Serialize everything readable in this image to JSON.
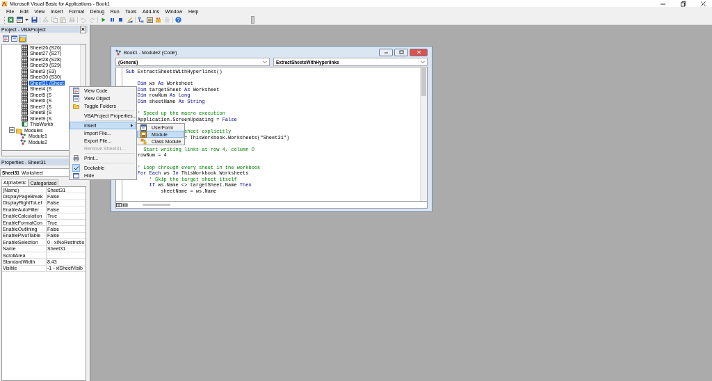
{
  "window": {
    "title": "Microsoft Visual Basic for Applications - Book1"
  },
  "menu_bar": [
    "File",
    "Edit",
    "View",
    "Insert",
    "Format",
    "Debug",
    "Run",
    "Tools",
    "Add-Ins",
    "Window",
    "Help"
  ],
  "toolbar": [
    {
      "kind": "excel",
      "disabled": false
    },
    {
      "kind": "userform",
      "disabled": false
    },
    {
      "kind": "save",
      "disabled": false
    },
    {
      "kind": "cut",
      "disabled": true
    },
    {
      "kind": "copy",
      "disabled": true
    },
    {
      "kind": "paste",
      "disabled": true
    },
    {
      "kind": "find",
      "disabled": true
    },
    {
      "kind": "undo",
      "disabled": true
    },
    {
      "kind": "redo",
      "disabled": true
    },
    {
      "kind": "run",
      "disabled": false
    },
    {
      "kind": "break",
      "disabled": false
    },
    {
      "kind": "reset",
      "disabled": false
    },
    {
      "kind": "design",
      "disabled": false
    },
    {
      "kind": "explorer",
      "disabled": false
    },
    {
      "kind": "properties",
      "disabled": false
    },
    {
      "kind": "browser",
      "disabled": false
    },
    {
      "kind": "toolbox",
      "disabled": true
    },
    {
      "kind": "help",
      "disabled": false
    }
  ],
  "project": {
    "title": "Project - VBAProject",
    "close": "×",
    "toolbar": [
      {
        "kind": "code",
        "pressed": false
      },
      {
        "kind": "object",
        "pressed": false
      },
      {
        "kind": "folders",
        "pressed": true
      }
    ],
    "tree": [
      {
        "label": "Sheet26 (S26)",
        "kind": "sheet",
        "selected": false
      },
      {
        "label": "Sheet27 (S27)",
        "kind": "sheet",
        "selected": false
      },
      {
        "label": "Sheet28 (S28)",
        "kind": "sheet",
        "selected": false
      },
      {
        "label": "Sheet29 (S29)",
        "kind": "sheet",
        "selected": false
      },
      {
        "label": "Sheet3 (S3)",
        "kind": "sheet",
        "selected": false
      },
      {
        "label": "Sheet30 (S30)",
        "kind": "sheet",
        "selected": false
      },
      {
        "label": "Sheet31 (Sheet",
        "kind": "sheet",
        "selected": true
      },
      {
        "label": "Sheet4 (S",
        "kind": "sheet",
        "selected": false
      },
      {
        "label": "Sheet5 (S",
        "kind": "sheet",
        "selected": false
      },
      {
        "label": "Sheet6 (S",
        "kind": "sheet",
        "selected": false
      },
      {
        "label": "Sheet7 (S",
        "kind": "sheet",
        "selected": false
      },
      {
        "label": "Sheet8 (S",
        "kind": "sheet",
        "selected": false
      },
      {
        "label": "Sheet9 (S",
        "kind": "sheet",
        "selected": false
      },
      {
        "label": "ThisWorkb",
        "kind": "workbook",
        "selected": false
      },
      {
        "label": "Modules",
        "kind": "folder",
        "selected": false,
        "expanded": true,
        "children": [
          {
            "label": "Module1",
            "kind": "module",
            "selected": false
          },
          {
            "label": "Module2",
            "kind": "module",
            "selected": false
          }
        ]
      }
    ]
  },
  "properties": {
    "title": "Properties - Sheet31",
    "object_name": "Sheet31",
    "object_type": "Worksheet",
    "tabs": [
      {
        "label": "Alphabetic",
        "selected": true
      },
      {
        "label": "Categorized",
        "selected": false
      }
    ],
    "rows": [
      {
        "name": "(Name)",
        "value": "Sheet31"
      },
      {
        "name": "DisplayPageBreak",
        "value": "False"
      },
      {
        "name": "DisplayRightToLef",
        "value": "False"
      },
      {
        "name": "EnableAutoFilter",
        "value": "False"
      },
      {
        "name": "EnableCalculation",
        "value": "True"
      },
      {
        "name": "EnableFormatCon",
        "value": "True"
      },
      {
        "name": "EnableOutlining",
        "value": "False"
      },
      {
        "name": "EnablePivotTable",
        "value": "False"
      },
      {
        "name": "EnableSelection",
        "value": "0 - xlNoRestrictio"
      },
      {
        "name": "Name",
        "value": "Sheet31"
      },
      {
        "name": "ScrollArea"
      },
      {
        "name": "StandardWidth",
        "value": "8.43"
      },
      {
        "name": "Visible",
        "value": "-1 - xlSheetVisib"
      }
    ]
  },
  "code_window": {
    "title": "Book1 - Module2 (Code)",
    "object_combo": "(General)",
    "procedure_combo": "ExtractSheetsWithHyperlinks",
    "lines": [
      {
        "kind": "code",
        "segments": [
          {
            "kind": "keyword",
            "text": "Sub"
          },
          {
            "kind": "plain",
            "text": " ExtractSheetsWithHyperlinks()"
          }
        ]
      },
      {
        "kind": "blank"
      },
      {
        "kind": "code",
        "segments": [
          {
            "kind": "keyword",
            "text": "    Dim"
          },
          {
            "kind": "plain",
            "text": " ws "
          },
          {
            "kind": "keyword",
            "text": "As"
          },
          {
            "kind": "plain",
            "text": " Worksheet"
          }
        ]
      },
      {
        "kind": "code",
        "segments": [
          {
            "kind": "keyword",
            "text": "    Dim"
          },
          {
            "kind": "plain",
            "text": " targetSheet "
          },
          {
            "kind": "keyword",
            "text": "As"
          },
          {
            "kind": "plain",
            "text": " Worksheet"
          }
        ]
      },
      {
        "kind": "code",
        "segments": [
          {
            "kind": "keyword",
            "text": "    Dim"
          },
          {
            "kind": "plain",
            "text": " rowNum "
          },
          {
            "kind": "keyword",
            "text": "As Long"
          }
        ]
      },
      {
        "kind": "code",
        "segments": [
          {
            "kind": "keyword",
            "text": "    Dim"
          },
          {
            "kind": "plain",
            "text": " sheetName "
          },
          {
            "kind": "keyword",
            "text": "As String"
          }
        ]
      },
      {
        "kind": "blank"
      },
      {
        "kind": "code",
        "segments": [
          {
            "kind": "comment",
            "text": "    ' Speed up the macro execution"
          }
        ]
      },
      {
        "kind": "code",
        "segments": [
          {
            "kind": "plain",
            "text": "    Application.ScreenUpdating = "
          },
          {
            "kind": "keyword",
            "text": "False"
          }
        ]
      },
      {
        "kind": "blank"
      },
      {
        "kind": "code",
        "segments": [
          {
            "kind": "comment",
            "text": "                    sheet explicitly"
          }
        ]
      },
      {
        "kind": "code",
        "segments": [
          {
            "kind": "plain",
            "text": "                    = ThisWorkbook.Worksheets(\"Sheet31\")"
          }
        ]
      },
      {
        "kind": "blank"
      },
      {
        "kind": "code",
        "segments": [
          {
            "kind": "comment",
            "text": "      Start writing links at row 4, column D"
          }
        ]
      },
      {
        "kind": "code",
        "segments": [
          {
            "kind": "plain",
            "text": "    rowNum = 4"
          }
        ]
      },
      {
        "kind": "blank"
      },
      {
        "kind": "code",
        "segments": [
          {
            "kind": "comment",
            "text": "    ' Loop through every sheet in the workbook"
          }
        ]
      },
      {
        "kind": "code",
        "segments": [
          {
            "kind": "keyword",
            "text": "    For Each"
          },
          {
            "kind": "plain",
            "text": " ws "
          },
          {
            "kind": "keyword",
            "text": "In"
          },
          {
            "kind": "plain",
            "text": " ThisWorkbook.Worksheets"
          }
        ]
      },
      {
        "kind": "code",
        "segments": [
          {
            "kind": "comment",
            "text": "        ' Skip the target sheet itself"
          }
        ]
      },
      {
        "kind": "code",
        "segments": [
          {
            "kind": "keyword",
            "text": "        If"
          },
          {
            "kind": "plain",
            "text": " ws.Name <> targetSheet.Name "
          },
          {
            "kind": "keyword",
            "text": "Then"
          }
        ]
      },
      {
        "kind": "code",
        "segments": [
          {
            "kind": "plain",
            "text": "            sheetName = ws.Name"
          }
        ]
      }
    ]
  },
  "context_menu": [
    {
      "kind": "code",
      "label": "View Code",
      "selected": false,
      "checked": false,
      "disabled": false
    },
    {
      "kind": "object",
      "label": "View Object",
      "selected": false,
      "checked": false,
      "disabled": false
    },
    {
      "kind": "folders",
      "label": "Toggle Folders",
      "selected": false,
      "checked": false,
      "disabled": false
    },
    {
      "kind": "separator"
    },
    {
      "kind": "item",
      "label": "VBAProject Properties...",
      "selected": false,
      "checked": false,
      "disabled": false
    },
    {
      "kind": "separator"
    },
    {
      "kind": "submenu",
      "label": "Insert",
      "selected": true,
      "checked": false,
      "disabled": false
    },
    {
      "kind": "item",
      "label": "Import File...",
      "selected": false,
      "checked": false,
      "disabled": false
    },
    {
      "kind": "item",
      "label": "Export File...",
      "selected": false,
      "checked": false,
      "disabled": false
    },
    {
      "kind": "item",
      "label": "Remove Sheet31...",
      "selected": false,
      "checked": false,
      "disabled": true
    },
    {
      "kind": "separator"
    },
    {
      "kind": "print",
      "label": "Print...",
      "selected": false,
      "checked": false,
      "disabled": false
    },
    {
      "kind": "separator"
    },
    {
      "kind": "item",
      "label": "Dockable",
      "selected": false,
      "checked": true,
      "disabled": false
    },
    {
      "kind": "hide",
      "label": "Hide",
      "selected": false,
      "checked": false,
      "disabled": false
    }
  ],
  "insert_submenu": [
    {
      "kind": "userform",
      "label": "UserForm",
      "selected": false,
      "checked": false,
      "disabled": false
    },
    {
      "kind": "module",
      "label": "Module",
      "selected": true,
      "checked": false,
      "disabled": false
    },
    {
      "kind": "class",
      "label": "Class Module",
      "selected": false,
      "checked": false,
      "disabled": false
    }
  ]
}
